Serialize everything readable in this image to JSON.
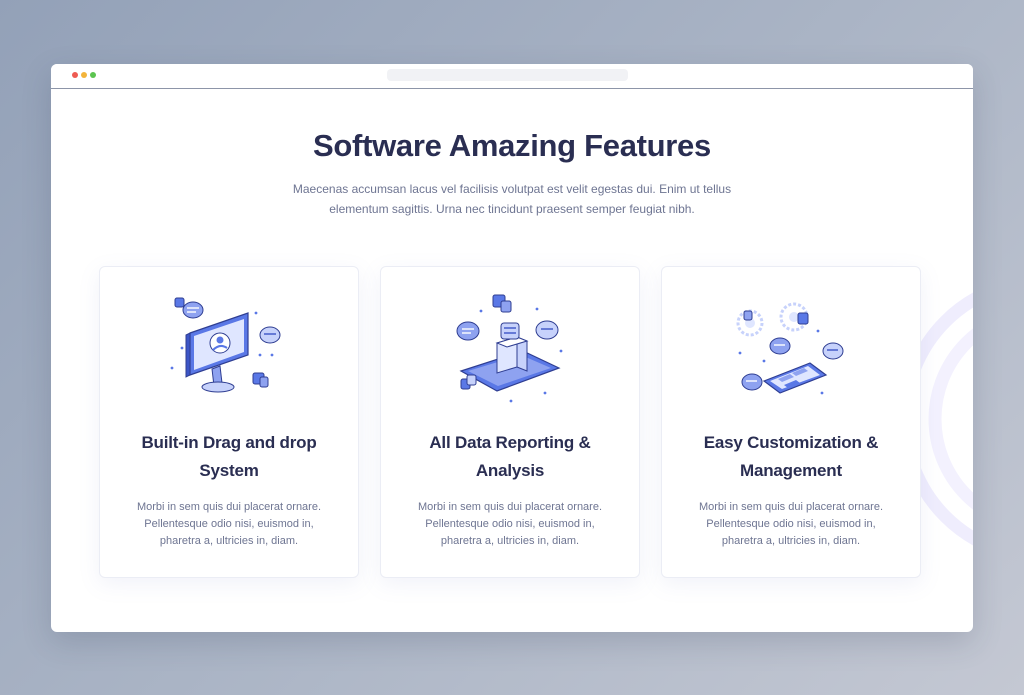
{
  "colors": {
    "accent": "#4a67e0",
    "heading": "#2a2e52",
    "body_text": "#6e7592"
  },
  "section": {
    "title": "Software Amazing Features",
    "subtitle": "Maecenas accumsan lacus vel facilisis volutpat est velit egestas dui. Enim ut tellus elementum sagittis. Urna nec tincidunt praesent semper feugiat nibh."
  },
  "features": [
    {
      "icon": "monitor-user-icon",
      "title": "Built-in Drag and drop System",
      "description": "Morbi in sem quis dui placerat ornare. Pellentesque odio nisi, euismod in, pharetra a, ultricies in, diam."
    },
    {
      "icon": "phone-server-icon",
      "title": "All Data Reporting & Analysis",
      "description": "Morbi in sem quis dui placerat ornare. Pellentesque odio nisi, euismod in, pharetra a, ultricies in, diam."
    },
    {
      "icon": "tablet-settings-icon",
      "title": "Easy Customization & Management",
      "description": "Morbi in sem quis dui placerat ornare. Pellentesque odio nisi, euismod in, pharetra a, ultricies in, diam."
    }
  ]
}
